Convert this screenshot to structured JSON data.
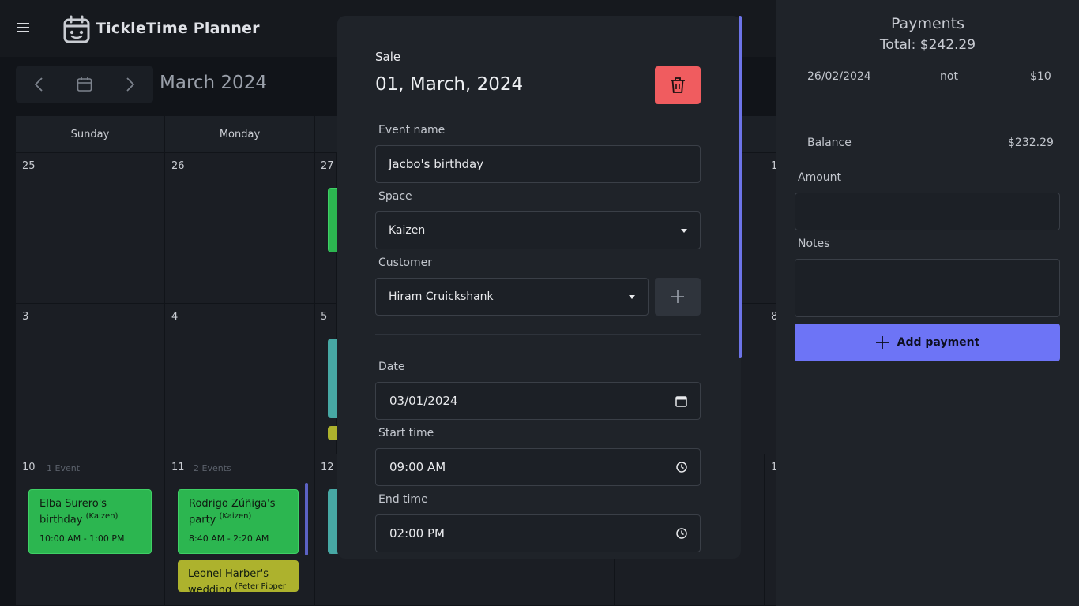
{
  "app": {
    "title": "TickleTime Planner"
  },
  "calendar": {
    "month_label": "March 2024",
    "weekdays": [
      "Sunday",
      "Monday"
    ],
    "weeks": [
      {
        "days": [
          "25",
          "26",
          "27",
          "1"
        ]
      },
      {
        "days": [
          "3",
          "4",
          "5",
          "8"
        ]
      },
      {
        "days": [
          "10",
          "11",
          "12",
          "1"
        ],
        "counts": [
          "1 Event",
          "2 Events"
        ]
      }
    ],
    "events": [
      {
        "title": "Elba Surero's birthday",
        "space": "(Kaizen)",
        "time": "10:00 AM - 1:00 PM",
        "color": "#2cb650"
      },
      {
        "title": "Rodrigo Zúñiga's party",
        "space": "(Kaizen)",
        "time": "8:40 AM - 2:20 AM",
        "color": "#2cb650"
      },
      {
        "title": "Leonel Harber's wedding",
        "space": "(Peter Pipper",
        "time": "",
        "color": "#adb22d"
      }
    ]
  },
  "modal": {
    "kind": "Sale",
    "date_title": "01, March, 2024",
    "fields": {
      "event_name": {
        "label": "Event name",
        "value": "Jacbo's birthday"
      },
      "space": {
        "label": "Space",
        "value": "Kaizen"
      },
      "customer": {
        "label": "Customer",
        "value": "Hiram Cruickshank"
      },
      "date": {
        "label": "Date",
        "value": "03/01/2024"
      },
      "start_time": {
        "label": "Start time",
        "value": "09:00 AM"
      },
      "end_time": {
        "label": "End time",
        "value": "02:00 PM"
      }
    },
    "colors": {
      "delete": "#f05c5f",
      "scrollbar": "#6d74e8"
    }
  },
  "payments": {
    "title": "Payments",
    "total": "Total: $242.29",
    "rows": [
      {
        "date": "26/02/2024",
        "status": "not",
        "amount": "$10"
      }
    ],
    "balance_label": "Balance",
    "balance_value": "$232.29",
    "amount_label": "Amount",
    "notes_label": "Notes",
    "add_label": "Add payment",
    "accent": "#6d74f6"
  }
}
